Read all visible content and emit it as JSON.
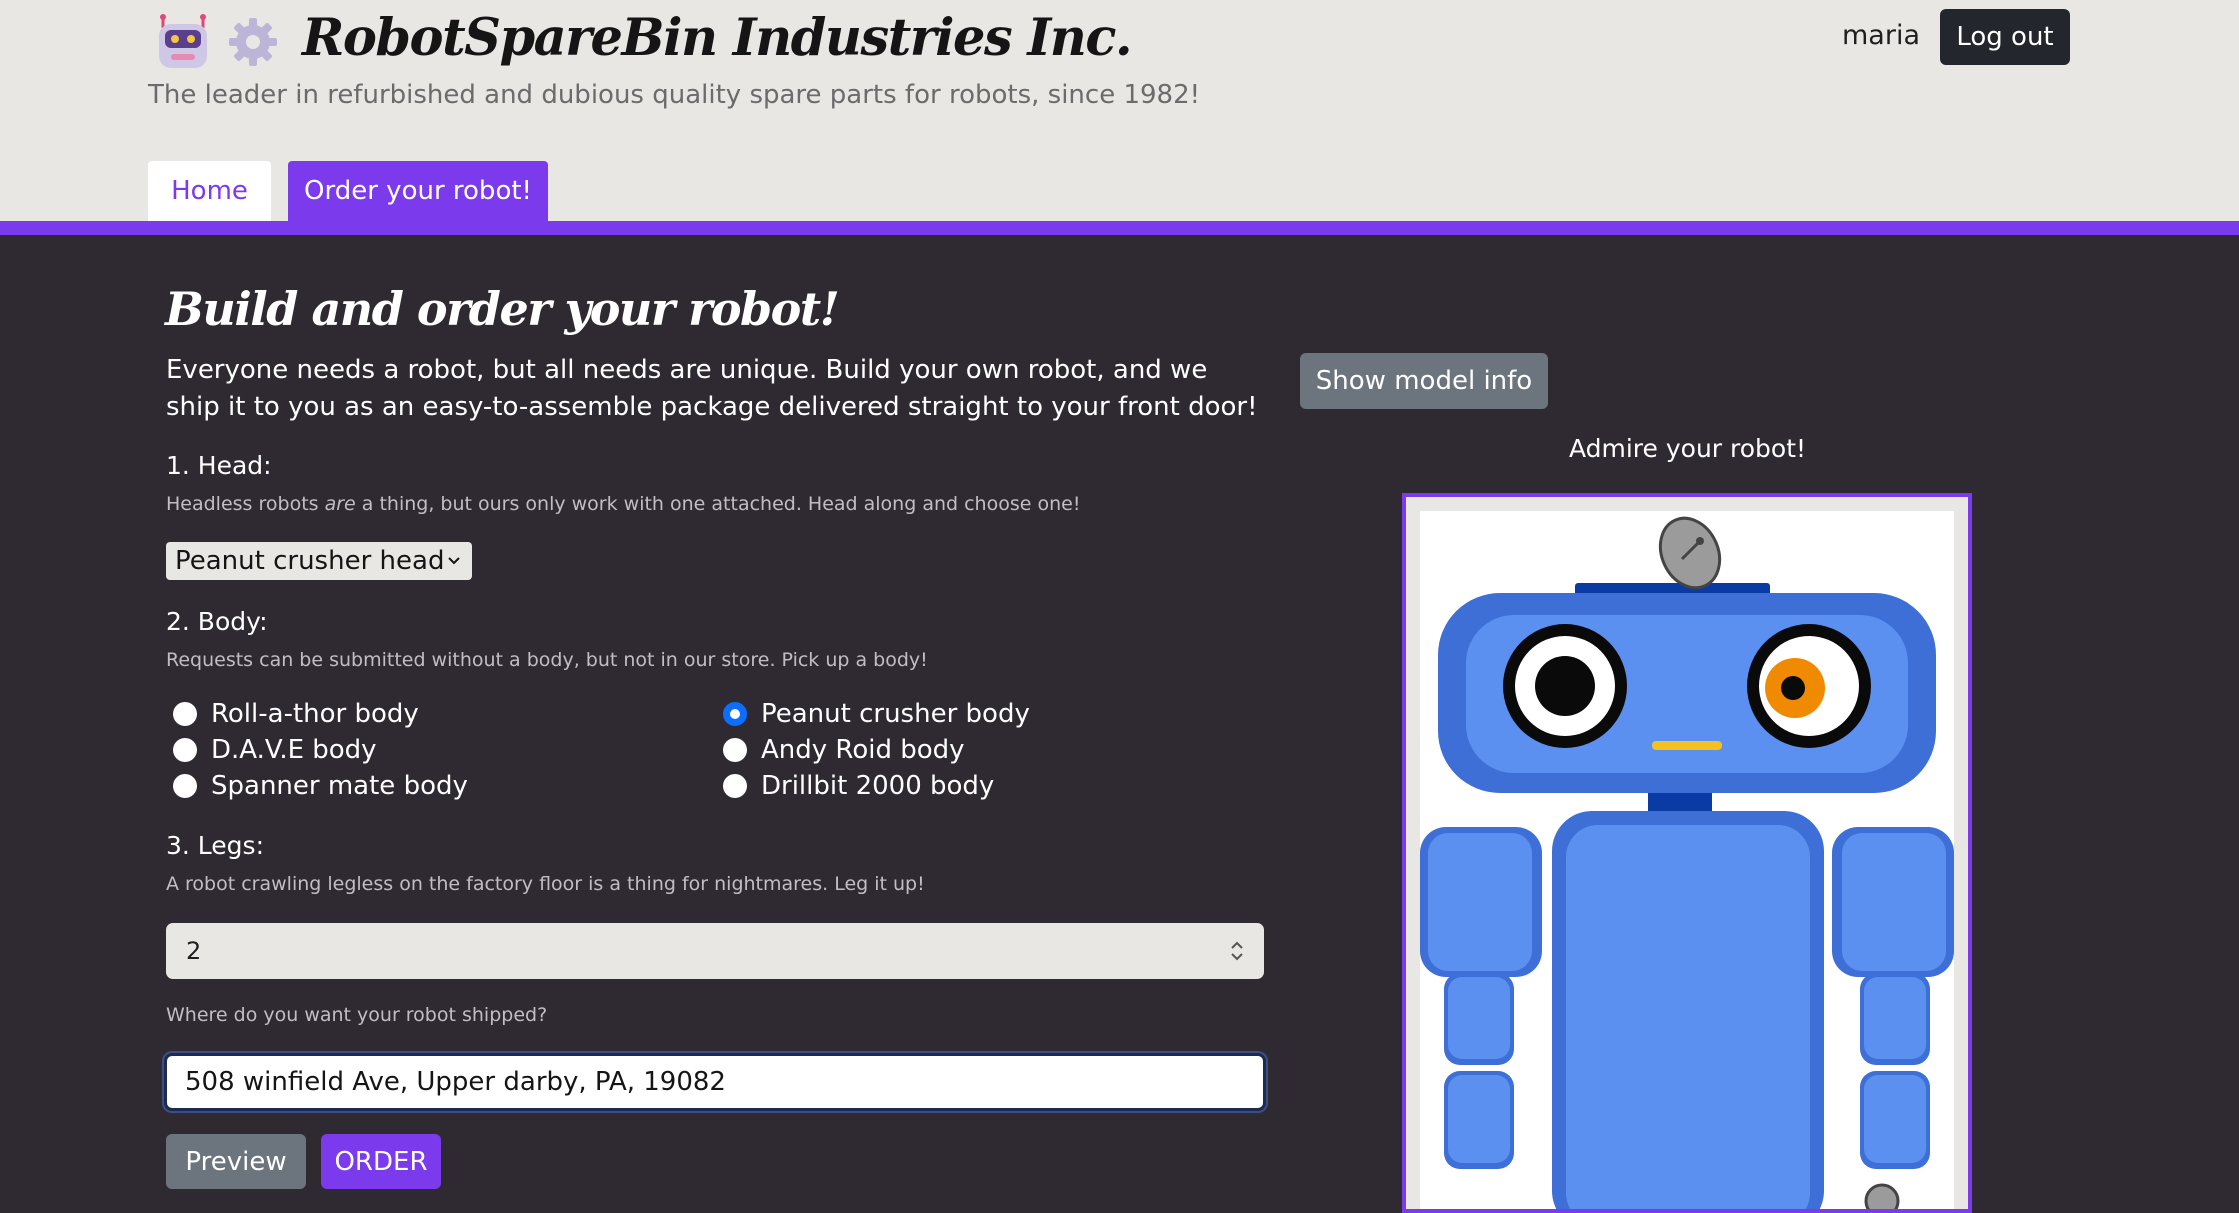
{
  "header": {
    "brand_title": "RobotSpareBin Industries Inc.",
    "tagline": "The leader in refurbished and dubious quality spare parts for robots, since 1982!",
    "icons": [
      "robot-icon",
      "gear-icon"
    ],
    "user": "maria",
    "logout_label": "Log out"
  },
  "tabs": [
    {
      "label": "Home",
      "active": false
    },
    {
      "label": "Order your robot!",
      "active": true
    }
  ],
  "form": {
    "heading": "Build and order your robot!",
    "intro": "Everyone needs a robot, but all needs are unique. Build your own robot, and we ship it to you as an easy-to-assemble package delivered straight to your front door!",
    "head": {
      "label": "1. Head:",
      "help_before": "Headless robots ",
      "help_em": "are",
      "help_after": " a thing, but ours only work with one attached. Head along and choose one!",
      "selected": "Peanut crusher head"
    },
    "body": {
      "label": "2. Body:",
      "help": "Requests can be submitted without a body, but not in our store. Pick up a body!",
      "options": [
        {
          "label": "Roll-a-thor body",
          "checked": false
        },
        {
          "label": "D.A.V.E body",
          "checked": false
        },
        {
          "label": "Spanner mate body",
          "checked": false
        },
        {
          "label": "Peanut crusher body",
          "checked": true
        },
        {
          "label": "Andy Roid body",
          "checked": false
        },
        {
          "label": "Drillbit 2000 body",
          "checked": false
        }
      ]
    },
    "legs": {
      "label": "3. Legs:",
      "help": "A robot crawling legless on the factory floor is a thing for nightmares. Leg it up!",
      "value": "2"
    },
    "address": {
      "label": "Where do you want your robot shipped?",
      "value": "508 winfield Ave, Upper darby, PA, 19082"
    },
    "preview_label": "Preview",
    "order_label": "ORDER"
  },
  "preview_panel": {
    "model_info_label": "Show model info",
    "admire_label": "Admire your robot!"
  },
  "colors": {
    "accent": "#7c3aed",
    "header_bg": "#e9e7e4",
    "page_bg": "#2f2a31",
    "robot_blue": "#3d6fd6"
  }
}
